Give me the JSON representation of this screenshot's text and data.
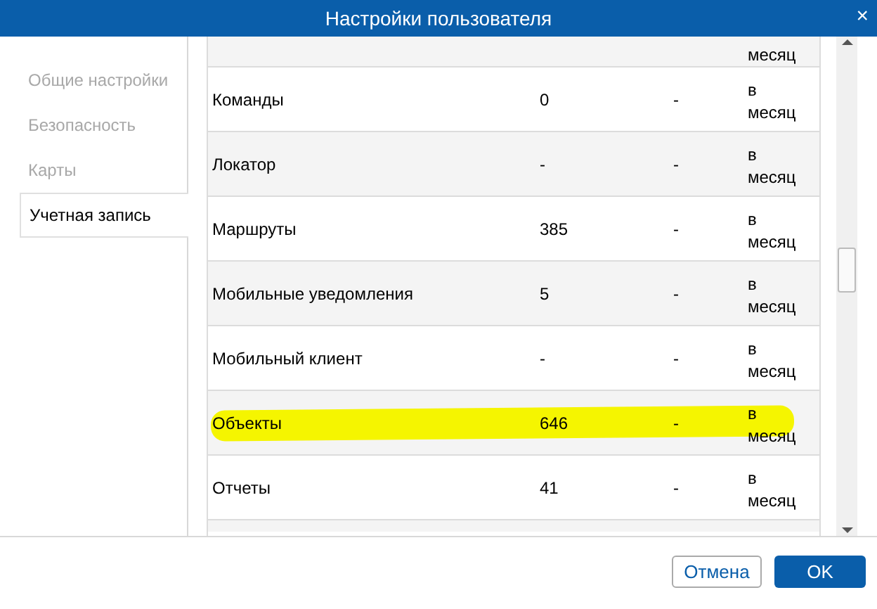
{
  "window": {
    "title": "Настройки пользователя",
    "close": "×"
  },
  "sidebar": {
    "items": [
      {
        "label": "Общие настройки",
        "selected": false
      },
      {
        "label": "Безопасность",
        "selected": false
      },
      {
        "label": "Карты",
        "selected": false
      },
      {
        "label": "Учетная запись",
        "selected": true
      }
    ]
  },
  "table": {
    "rows": [
      {
        "kind": "partial",
        "cells": [
          "",
          "",
          "",
          "месяц"
        ]
      },
      {
        "kind": "full",
        "cells": [
          "Команды",
          "0",
          "-",
          "в месяц"
        ],
        "highlighted": false
      },
      {
        "kind": "full",
        "cells": [
          "Локатор",
          "-",
          "-",
          "в месяц"
        ],
        "highlighted": false
      },
      {
        "kind": "full",
        "cells": [
          "Маршруты",
          "385",
          "-",
          "в месяц"
        ],
        "highlighted": false
      },
      {
        "kind": "full",
        "cells": [
          "Мобильные уведомления",
          "5",
          "-",
          "в месяц"
        ],
        "highlighted": false
      },
      {
        "kind": "full",
        "cells": [
          "Мобильный клиент",
          "-",
          "-",
          "в месяц"
        ],
        "highlighted": false
      },
      {
        "kind": "full",
        "cells": [
          "Объекты",
          "646",
          "-",
          "в месяц"
        ],
        "highlighted": true
      },
      {
        "kind": "full",
        "cells": [
          "Отчеты",
          "41",
          "-",
          "в месяц"
        ],
        "highlighted": false
      },
      {
        "kind": "empty",
        "cells": []
      }
    ]
  },
  "buttons": [
    {
      "label": "Отмена",
      "kind": "secondary"
    },
    {
      "label": "OK",
      "kind": "primary"
    }
  ]
}
